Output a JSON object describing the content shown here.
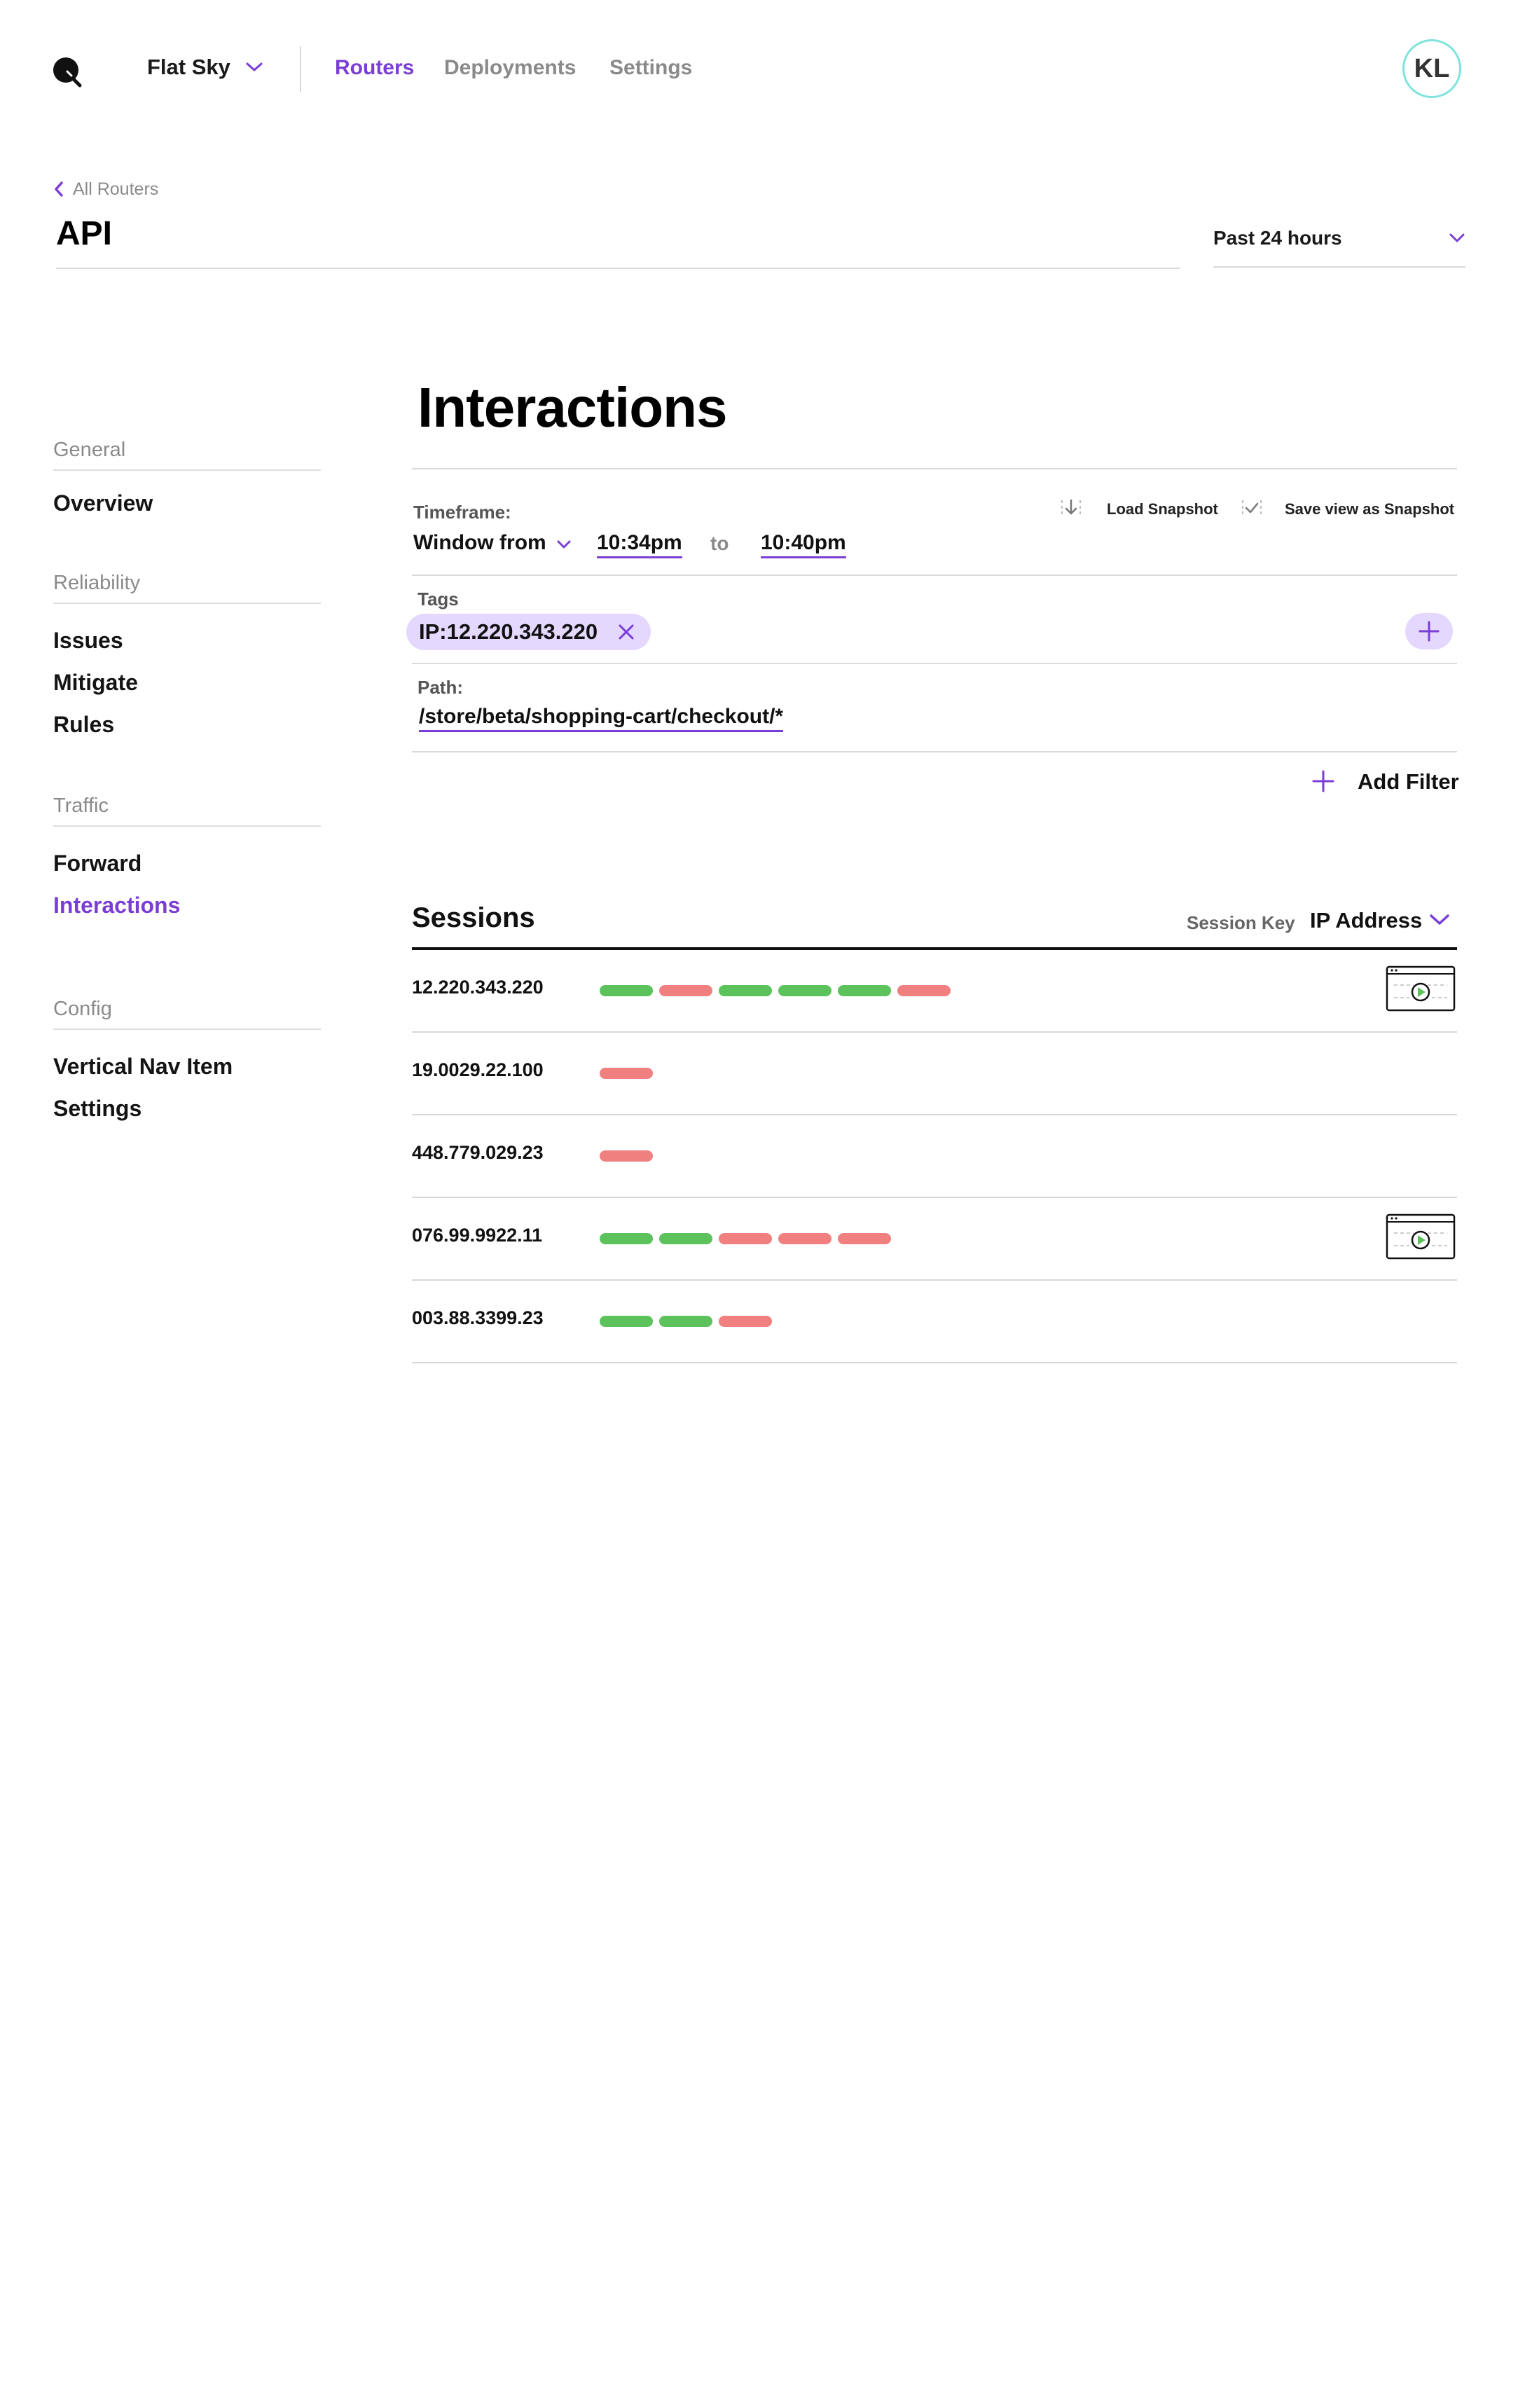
{
  "topbar": {
    "org": "Flat Sky",
    "nav": [
      "Routers",
      "Deployments",
      "Settings"
    ],
    "active_nav": "Routers",
    "avatar_initials": "KL"
  },
  "header": {
    "breadcrumb": "All Routers",
    "title": "API",
    "time_range": "Past 24 hours"
  },
  "sidebar": {
    "sections": [
      {
        "heading": "General",
        "items": [
          "Overview"
        ]
      },
      {
        "heading": "Reliability",
        "items": [
          "Issues",
          "Mitigate",
          "Rules"
        ]
      },
      {
        "heading": "Traffic",
        "items": [
          "Forward",
          "Interactions"
        ]
      },
      {
        "heading": "Config",
        "items": [
          "Vertical Nav Item",
          "Settings"
        ]
      }
    ],
    "active_item": "Interactions"
  },
  "main": {
    "title": "Interactions",
    "timeframe": {
      "label": "Timeframe:",
      "mode": "Window from",
      "from": "10:34pm",
      "to_word": "to",
      "to": "10:40pm"
    },
    "snapshot": {
      "load": "Load Snapshot",
      "save": "Save view as Snapshot"
    },
    "tags": {
      "label": "Tags",
      "items": [
        "IP:12.220.343.220"
      ]
    },
    "path": {
      "label": "Path:",
      "value": "/store/beta/shopping-cart/checkout/*"
    },
    "add_filter": "Add Filter",
    "sessions": {
      "title": "Sessions",
      "key_label": "Session Key",
      "key_value": "IP Address",
      "rows": [
        {
          "ip": "12.220.343.220",
          "bars": [
            "ok",
            "err",
            "ok",
            "ok",
            "ok",
            "err"
          ],
          "replay": true
        },
        {
          "ip": "19.0029.22.100",
          "bars": [
            "err"
          ],
          "replay": false
        },
        {
          "ip": "448.779.029.23",
          "bars": [
            "err"
          ],
          "replay": false
        },
        {
          "ip": "076.99.9922.11",
          "bars": [
            "ok",
            "ok",
            "err",
            "err",
            "err"
          ],
          "replay": true
        },
        {
          "ip": "003.88.3399.23",
          "bars": [
            "ok",
            "ok",
            "err"
          ],
          "replay": false
        }
      ]
    }
  },
  "colors": {
    "accent": "#7a3ed6",
    "ok": "#5cc35c",
    "err": "#f08080",
    "tag_bg": "#e4d8ff",
    "avatar_ring": "#7fe3de"
  }
}
